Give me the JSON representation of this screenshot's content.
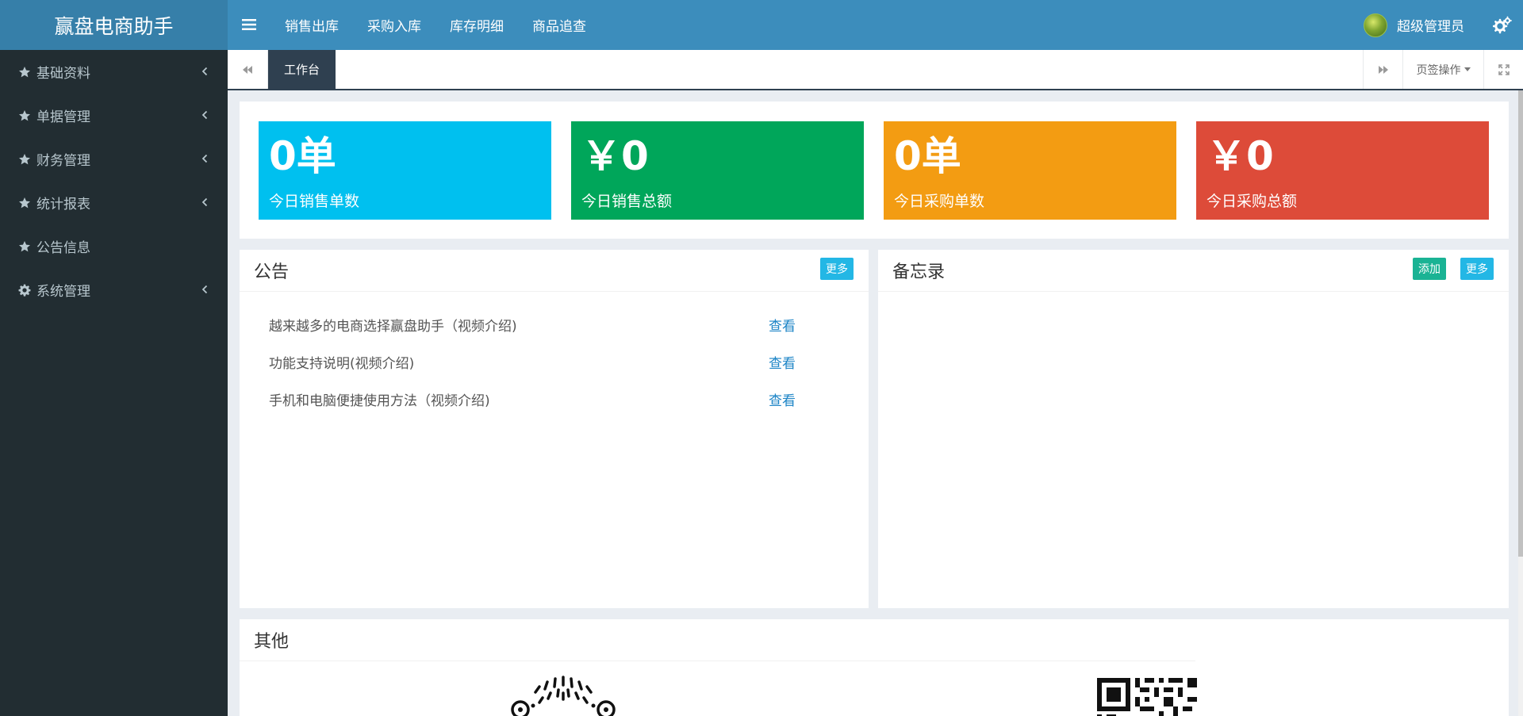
{
  "app": {
    "title": "赢盘电商助手"
  },
  "header": {
    "nav": [
      {
        "label": "销售出库"
      },
      {
        "label": "采购入库"
      },
      {
        "label": "库存明细"
      },
      {
        "label": "商品追查"
      }
    ],
    "user_name": "超级管理员"
  },
  "sidebar": {
    "items": [
      {
        "label": "基础资料",
        "icon": "star-icon",
        "has_children": true
      },
      {
        "label": "单据管理",
        "icon": "star-icon",
        "has_children": true
      },
      {
        "label": "财务管理",
        "icon": "star-icon",
        "has_children": true
      },
      {
        "label": "统计报表",
        "icon": "star-icon",
        "has_children": true
      },
      {
        "label": "公告信息",
        "icon": "star-icon",
        "has_children": false
      },
      {
        "label": "系统管理",
        "icon": "gear-icon",
        "has_children": true
      }
    ]
  },
  "tabs": {
    "active_label": "工作台",
    "operations_label": "页签操作"
  },
  "stats": [
    {
      "value": "0单",
      "label": "今日销售单数",
      "color": "#00c0ef"
    },
    {
      "value": "￥0",
      "label": "今日销售总额",
      "color": "#00a65a"
    },
    {
      "value": "0单",
      "label": "今日采购单数",
      "color": "#f39c12"
    },
    {
      "value": "￥0",
      "label": "今日采购总额",
      "color": "#dd4b39"
    }
  ],
  "notice": {
    "title": "公告",
    "more_label": "更多",
    "view_label": "查看",
    "items": [
      {
        "title": "越来越多的电商选择赢盘助手（视频介绍)"
      },
      {
        "title": "功能支持说明(视频介绍)"
      },
      {
        "title": "手机和电脑便捷使用方法（视频介绍)"
      }
    ]
  },
  "memo": {
    "title": "备忘录",
    "add_label": "添加",
    "more_label": "更多"
  },
  "other": {
    "title": "其他"
  },
  "colors": {
    "header": "#3c8dbc",
    "logo_bg": "#367fa9",
    "sidebar": "#222d32",
    "tab_active": "#2f4050",
    "link": "#1c84c6",
    "btn_blue": "#23b7e5",
    "btn_green": "#1ab394"
  }
}
